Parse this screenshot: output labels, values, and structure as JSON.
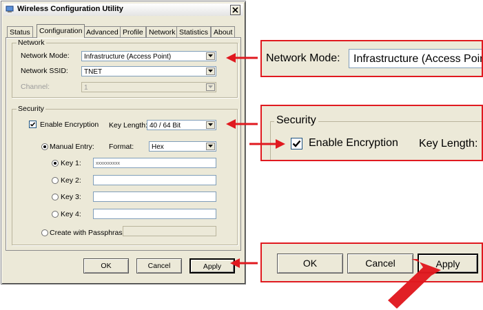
{
  "window": {
    "title": "Wireless Configuration Utility"
  },
  "tabs": [
    "Status",
    "Configuration",
    "Advanced",
    "Profile",
    "Network",
    "Statistics",
    "About"
  ],
  "network": {
    "legend": "Network",
    "mode_label": "Network Mode:",
    "mode_value": "Infrastructure (Access Point)",
    "ssid_label": "Network SSID:",
    "ssid_value": "TNET",
    "channel_label": "Channel:",
    "channel_value": "1"
  },
  "security": {
    "legend": "Security",
    "enable_label": "Enable Encryption",
    "enable_checked": true,
    "key_length_label": "Key Length:",
    "key_length_value": "40 / 64 Bit",
    "manual_entry_label": "Manual Entry:",
    "format_label": "Format:",
    "format_value": "Hex",
    "keys": [
      {
        "label": "Key 1:",
        "value": "xxxxxxxxxx",
        "selected": true
      },
      {
        "label": "Key 2:",
        "value": "",
        "selected": false
      },
      {
        "label": "Key 3:",
        "value": "",
        "selected": false
      },
      {
        "label": "Key 4:",
        "value": "",
        "selected": false
      }
    ],
    "passphrase_label": "Create with Passphrase:"
  },
  "buttons": {
    "ok": "OK",
    "cancel": "Cancel",
    "apply": "Apply"
  },
  "zoom_network": {
    "label": "Network Mode:",
    "value": "Infrastructure (Access Point)"
  },
  "zoom_security": {
    "legend": "Security",
    "enable_label": "Enable Encryption",
    "key_length_label": "Key Length:"
  },
  "zoom_buttons": {
    "ok": "OK",
    "cancel": "Cancel",
    "apply": "Apply"
  },
  "colors": {
    "callout": "#e0191f",
    "dialog_bg": "#ece9d8"
  }
}
